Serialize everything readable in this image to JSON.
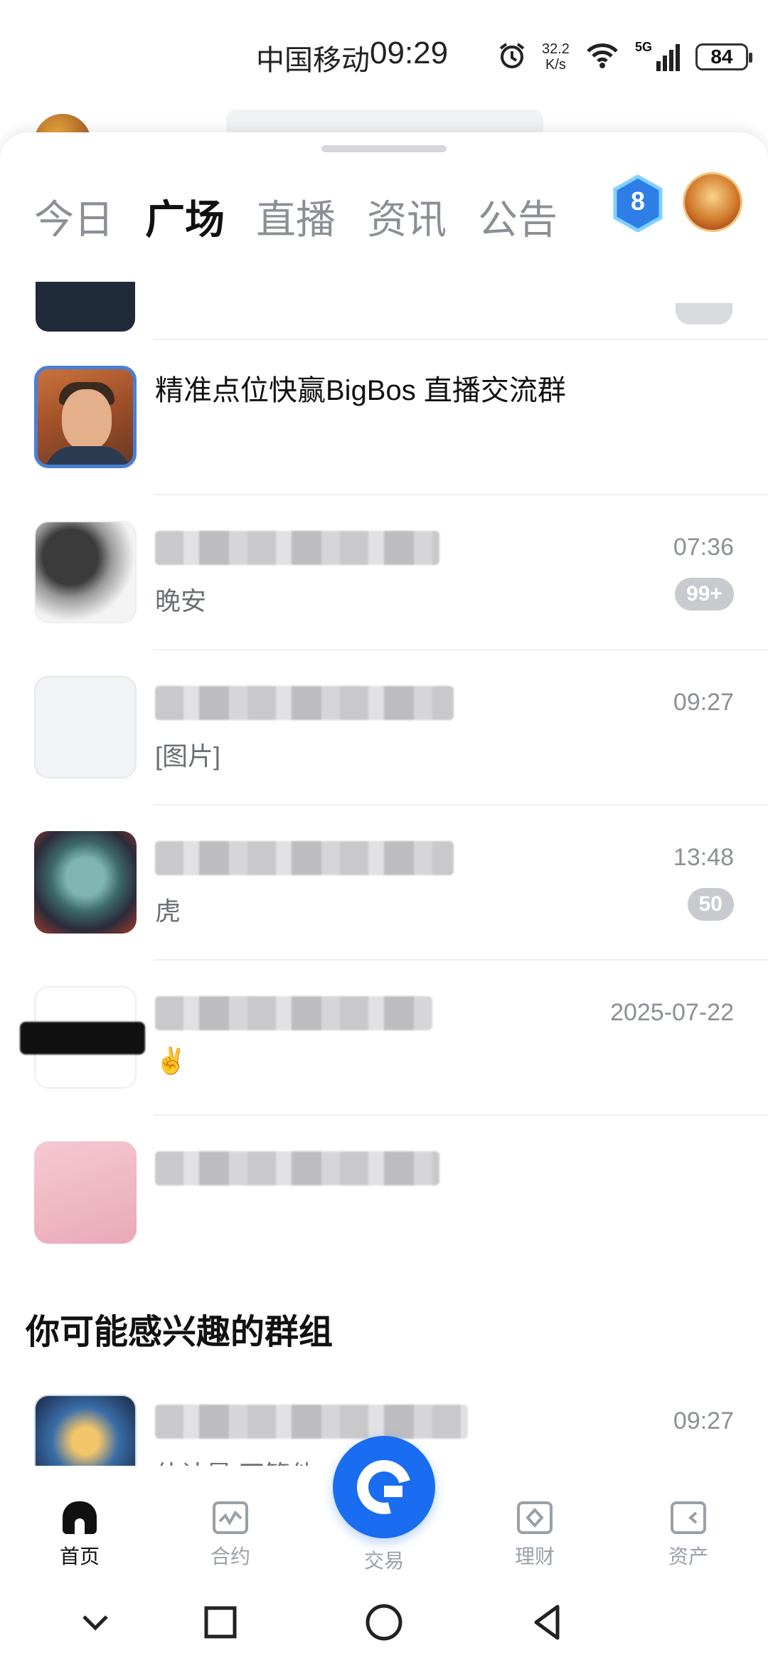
{
  "status_bar": {
    "carrier": "中国移动",
    "time": "09:29",
    "speed_top": "32.2",
    "speed_bottom": "K/s",
    "network": "5G",
    "battery": "84"
  },
  "tabs": [
    {
      "label": "今日",
      "active": false
    },
    {
      "label": "广场",
      "active": true
    },
    {
      "label": "直播",
      "active": false
    },
    {
      "label": "资讯",
      "active": false
    },
    {
      "label": "公告",
      "active": false
    }
  ],
  "level_badge": "8",
  "chats": [
    {
      "name": "精准点位快赢BigBos 直播交流群",
      "message": "",
      "time": "",
      "badge": ""
    },
    {
      "name": "",
      "message": "晚安",
      "time": "07:36",
      "badge": "99+"
    },
    {
      "name": "",
      "message": "[图片]",
      "time": "09:27",
      "badge": ""
    },
    {
      "name": "",
      "message": "虎",
      "time": "13:48",
      "badge": "50"
    },
    {
      "name": "",
      "message": "✌️",
      "time": "2025-07-22",
      "badge": ""
    },
    {
      "name": "",
      "message": "",
      "time": "",
      "badge": ""
    }
  ],
  "section_title": "你可能感兴趣的群组",
  "suggested": [
    {
      "name": "",
      "message": "估计是 不管他",
      "time": "09:27"
    }
  ],
  "bottom_nav": {
    "home": "首页",
    "contract": "合约",
    "trade": "交易",
    "finance": "理财",
    "assets": "资产"
  },
  "colors": {
    "accent": "#1a6cf0",
    "muted": "#8c9096",
    "badge": "#c8cacf"
  }
}
